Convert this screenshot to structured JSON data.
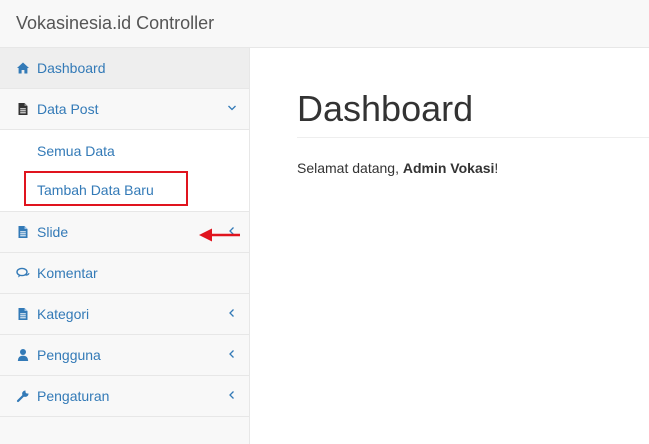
{
  "app": {
    "brand": "Vokasinesia.id Controller"
  },
  "sidebar": {
    "items": [
      {
        "label": "Dashboard",
        "icon": "home-icon"
      },
      {
        "label": "Data Post",
        "icon": "file-icon",
        "expanded": true,
        "children": [
          {
            "label": "Semua Data"
          },
          {
            "label": "Tambah Data Baru"
          }
        ]
      },
      {
        "label": "Slide",
        "icon": "file-icon"
      },
      {
        "label": "Komentar",
        "icon": "comments-icon"
      },
      {
        "label": "Kategori",
        "icon": "file-icon"
      },
      {
        "label": "Pengguna",
        "icon": "user-icon"
      },
      {
        "label": "Pengaturan",
        "icon": "wrench-icon"
      }
    ]
  },
  "main": {
    "title": "Dashboard",
    "welcome_prefix": "Selamat datang, ",
    "welcome_name": "Admin Vokasi",
    "welcome_suffix": "!"
  },
  "colors": {
    "link": "#337ab7",
    "highlight": "#e0141e",
    "sidebar_bg": "#f8f8f8"
  }
}
